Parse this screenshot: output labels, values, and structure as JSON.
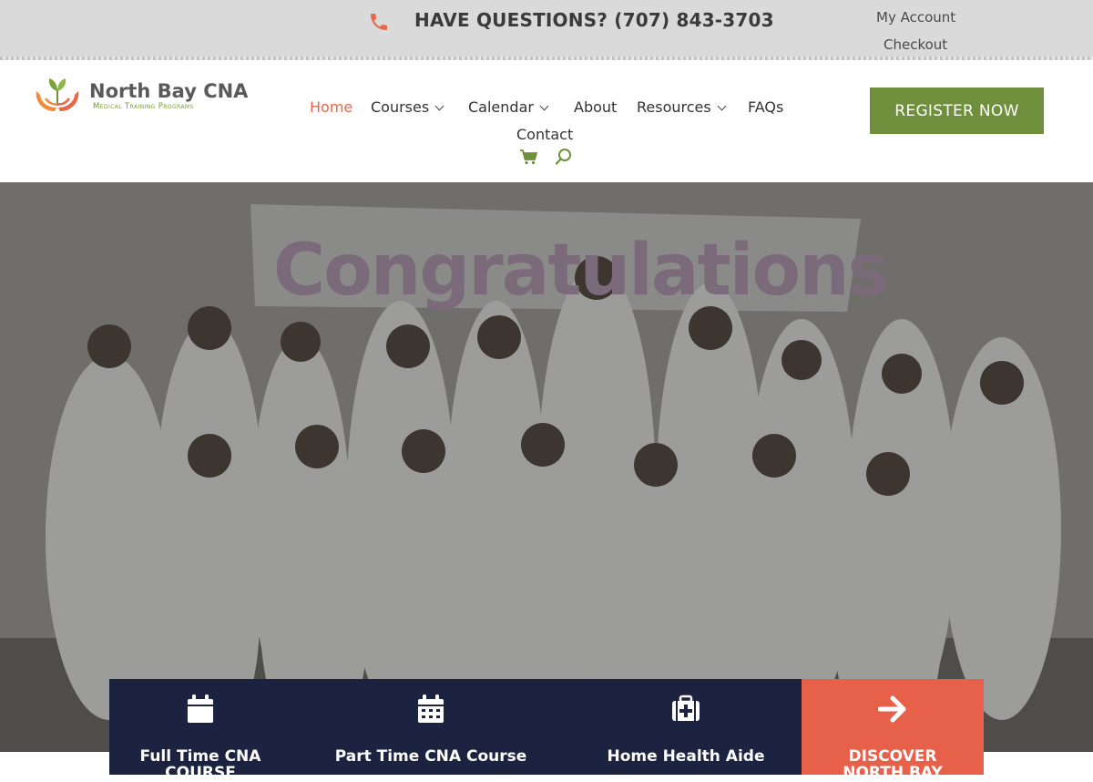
{
  "topbar": {
    "questions_text": "HAVE QUESTIONS? (707) 843-3703",
    "links": {
      "my_account": "My Account",
      "checkout": "Checkout"
    },
    "icon": "phone-icon"
  },
  "header": {
    "logo": {
      "title": "North Bay CNA",
      "subtitle": "Medical Training Programs"
    },
    "nav": [
      {
        "label": "Home",
        "active": true,
        "dropdown": false
      },
      {
        "label": "Courses",
        "active": false,
        "dropdown": true
      },
      {
        "label": "Calendar",
        "active": false,
        "dropdown": true
      },
      {
        "label": "About",
        "active": false,
        "dropdown": false
      },
      {
        "label": "Resources",
        "active": false,
        "dropdown": true
      },
      {
        "label": "FAQs",
        "active": false,
        "dropdown": false
      },
      {
        "label": "Contact",
        "active": false,
        "dropdown": false
      }
    ],
    "icons": [
      "cart-icon",
      "search-icon"
    ],
    "register_label": "REGISTER NOW"
  },
  "hero": {
    "banner_text": "Congratulations"
  },
  "features": [
    {
      "label": "Full Time CNA COURSE",
      "icon": "calendar-icon"
    },
    {
      "label": "Part Time CNA Course",
      "icon": "calendar-grid-icon"
    },
    {
      "label": "Home Health Aide",
      "icon": "medical-kit-icon"
    },
    {
      "label": "DISCOVER NORTH BAY",
      "icon": "arrow-right-icon"
    }
  ],
  "colors": {
    "accent_orange": "#e6604a",
    "brand_green": "#6f8f3c",
    "navy": "#1c2341",
    "topbar_bg": "#dadada"
  }
}
